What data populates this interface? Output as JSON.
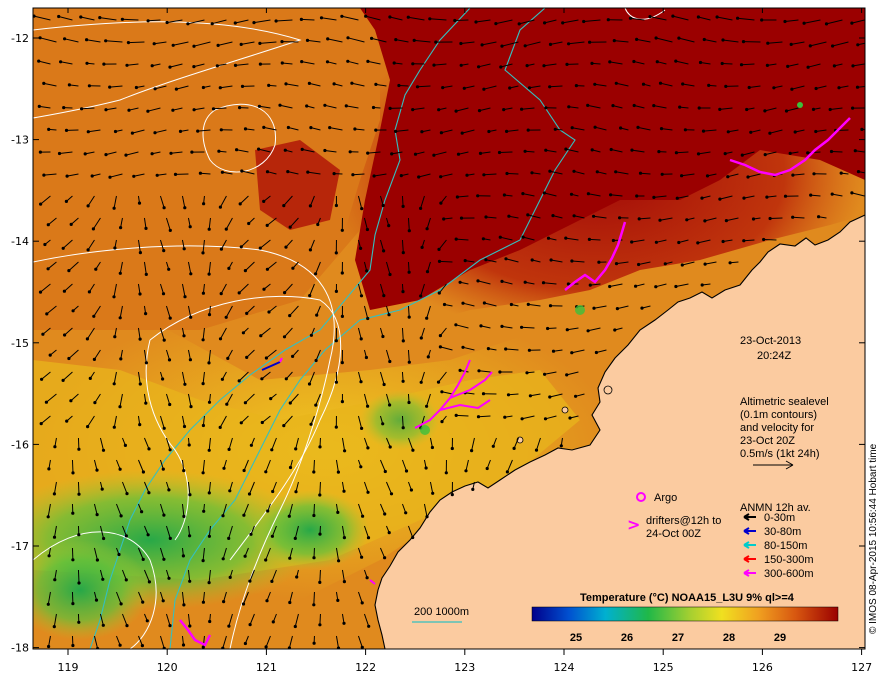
{
  "map": {
    "lon_ticks": [
      "119",
      "120",
      "121",
      "122",
      "123",
      "124",
      "125",
      "126",
      "127"
    ],
    "lat_ticks": [
      "-12",
      "-13",
      "-14",
      "-15",
      "-16",
      "-17",
      "-18"
    ]
  },
  "info": {
    "date": "23-Oct-2013",
    "time": "20:24Z",
    "altimetry_lines": [
      "Altimetric sealevel",
      "(0.1m contours)",
      "and velocity for",
      "23-Oct 20Z",
      "0.5m/s (1kt 24h)"
    ]
  },
  "legend": {
    "argo_label": "Argo",
    "drifters_lines": [
      "drifters@12h to",
      "24-Oct 00Z"
    ],
    "anmn_title": "ANMN 12h av.",
    "depth_bands": [
      {
        "label": "0-30m",
        "color": "#000000"
      },
      {
        "label": "30-80m",
        "color": "#0000cc"
      },
      {
        "label": "80-150m",
        "color": "#00cccc"
      },
      {
        "label": "150-300m",
        "color": "#ff0000"
      },
      {
        "label": "300-600m",
        "color": "#ff00ff"
      }
    ],
    "contour_label": "200  1000m"
  },
  "colorbar": {
    "title": "Temperature (°C) NOAA15_L3U 9% ql>=4",
    "ticks": [
      "25",
      "26",
      "27",
      "28",
      "29"
    ]
  },
  "credit": "© IMOS 08-Apr-2015 10:56:44 Hobart time",
  "colors": {
    "land": "#fbcba0",
    "warm": "#9b0000",
    "orange": "#e08a1e",
    "yellow": "#e6c21c",
    "green": "#3cbf3c",
    "contour": "#34c0c0"
  }
}
